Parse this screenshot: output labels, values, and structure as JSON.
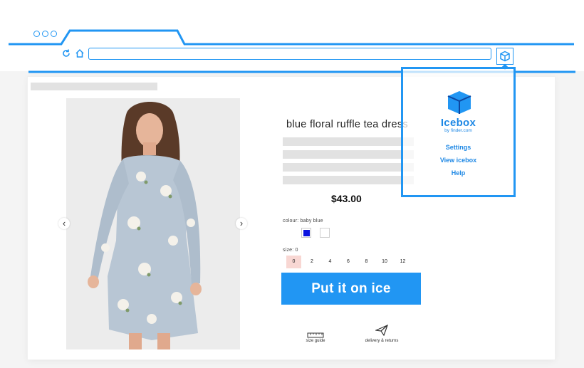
{
  "colors": {
    "accent": "#2196f3",
    "swatch_blue": "#0a12e0",
    "swatch_white": "#ffffff",
    "selected_size_bg": "#f8d7d3"
  },
  "browser": {
    "window_dots": [
      "dot",
      "dot",
      "dot"
    ],
    "icons": [
      "refresh-icon",
      "home-icon",
      "icebox-extension-icon"
    ]
  },
  "product": {
    "title": "blue floral ruffle tea dress",
    "price": "$43.00",
    "colour_label": "colour: baby blue",
    "size_label": "size: 0",
    "sizes": [
      "0",
      "2",
      "4",
      "6",
      "8",
      "10",
      "12"
    ],
    "selected_size": "0",
    "cta_label": "Put it on ice",
    "carousel_prev": "‹",
    "carousel_next": "›"
  },
  "footer": {
    "size_guide": "size guide",
    "delivery": "delivery & returns"
  },
  "popup": {
    "brand": "Icebox",
    "byline": "by finder.com",
    "links": [
      "Settings",
      "View icebox",
      "Help"
    ]
  }
}
